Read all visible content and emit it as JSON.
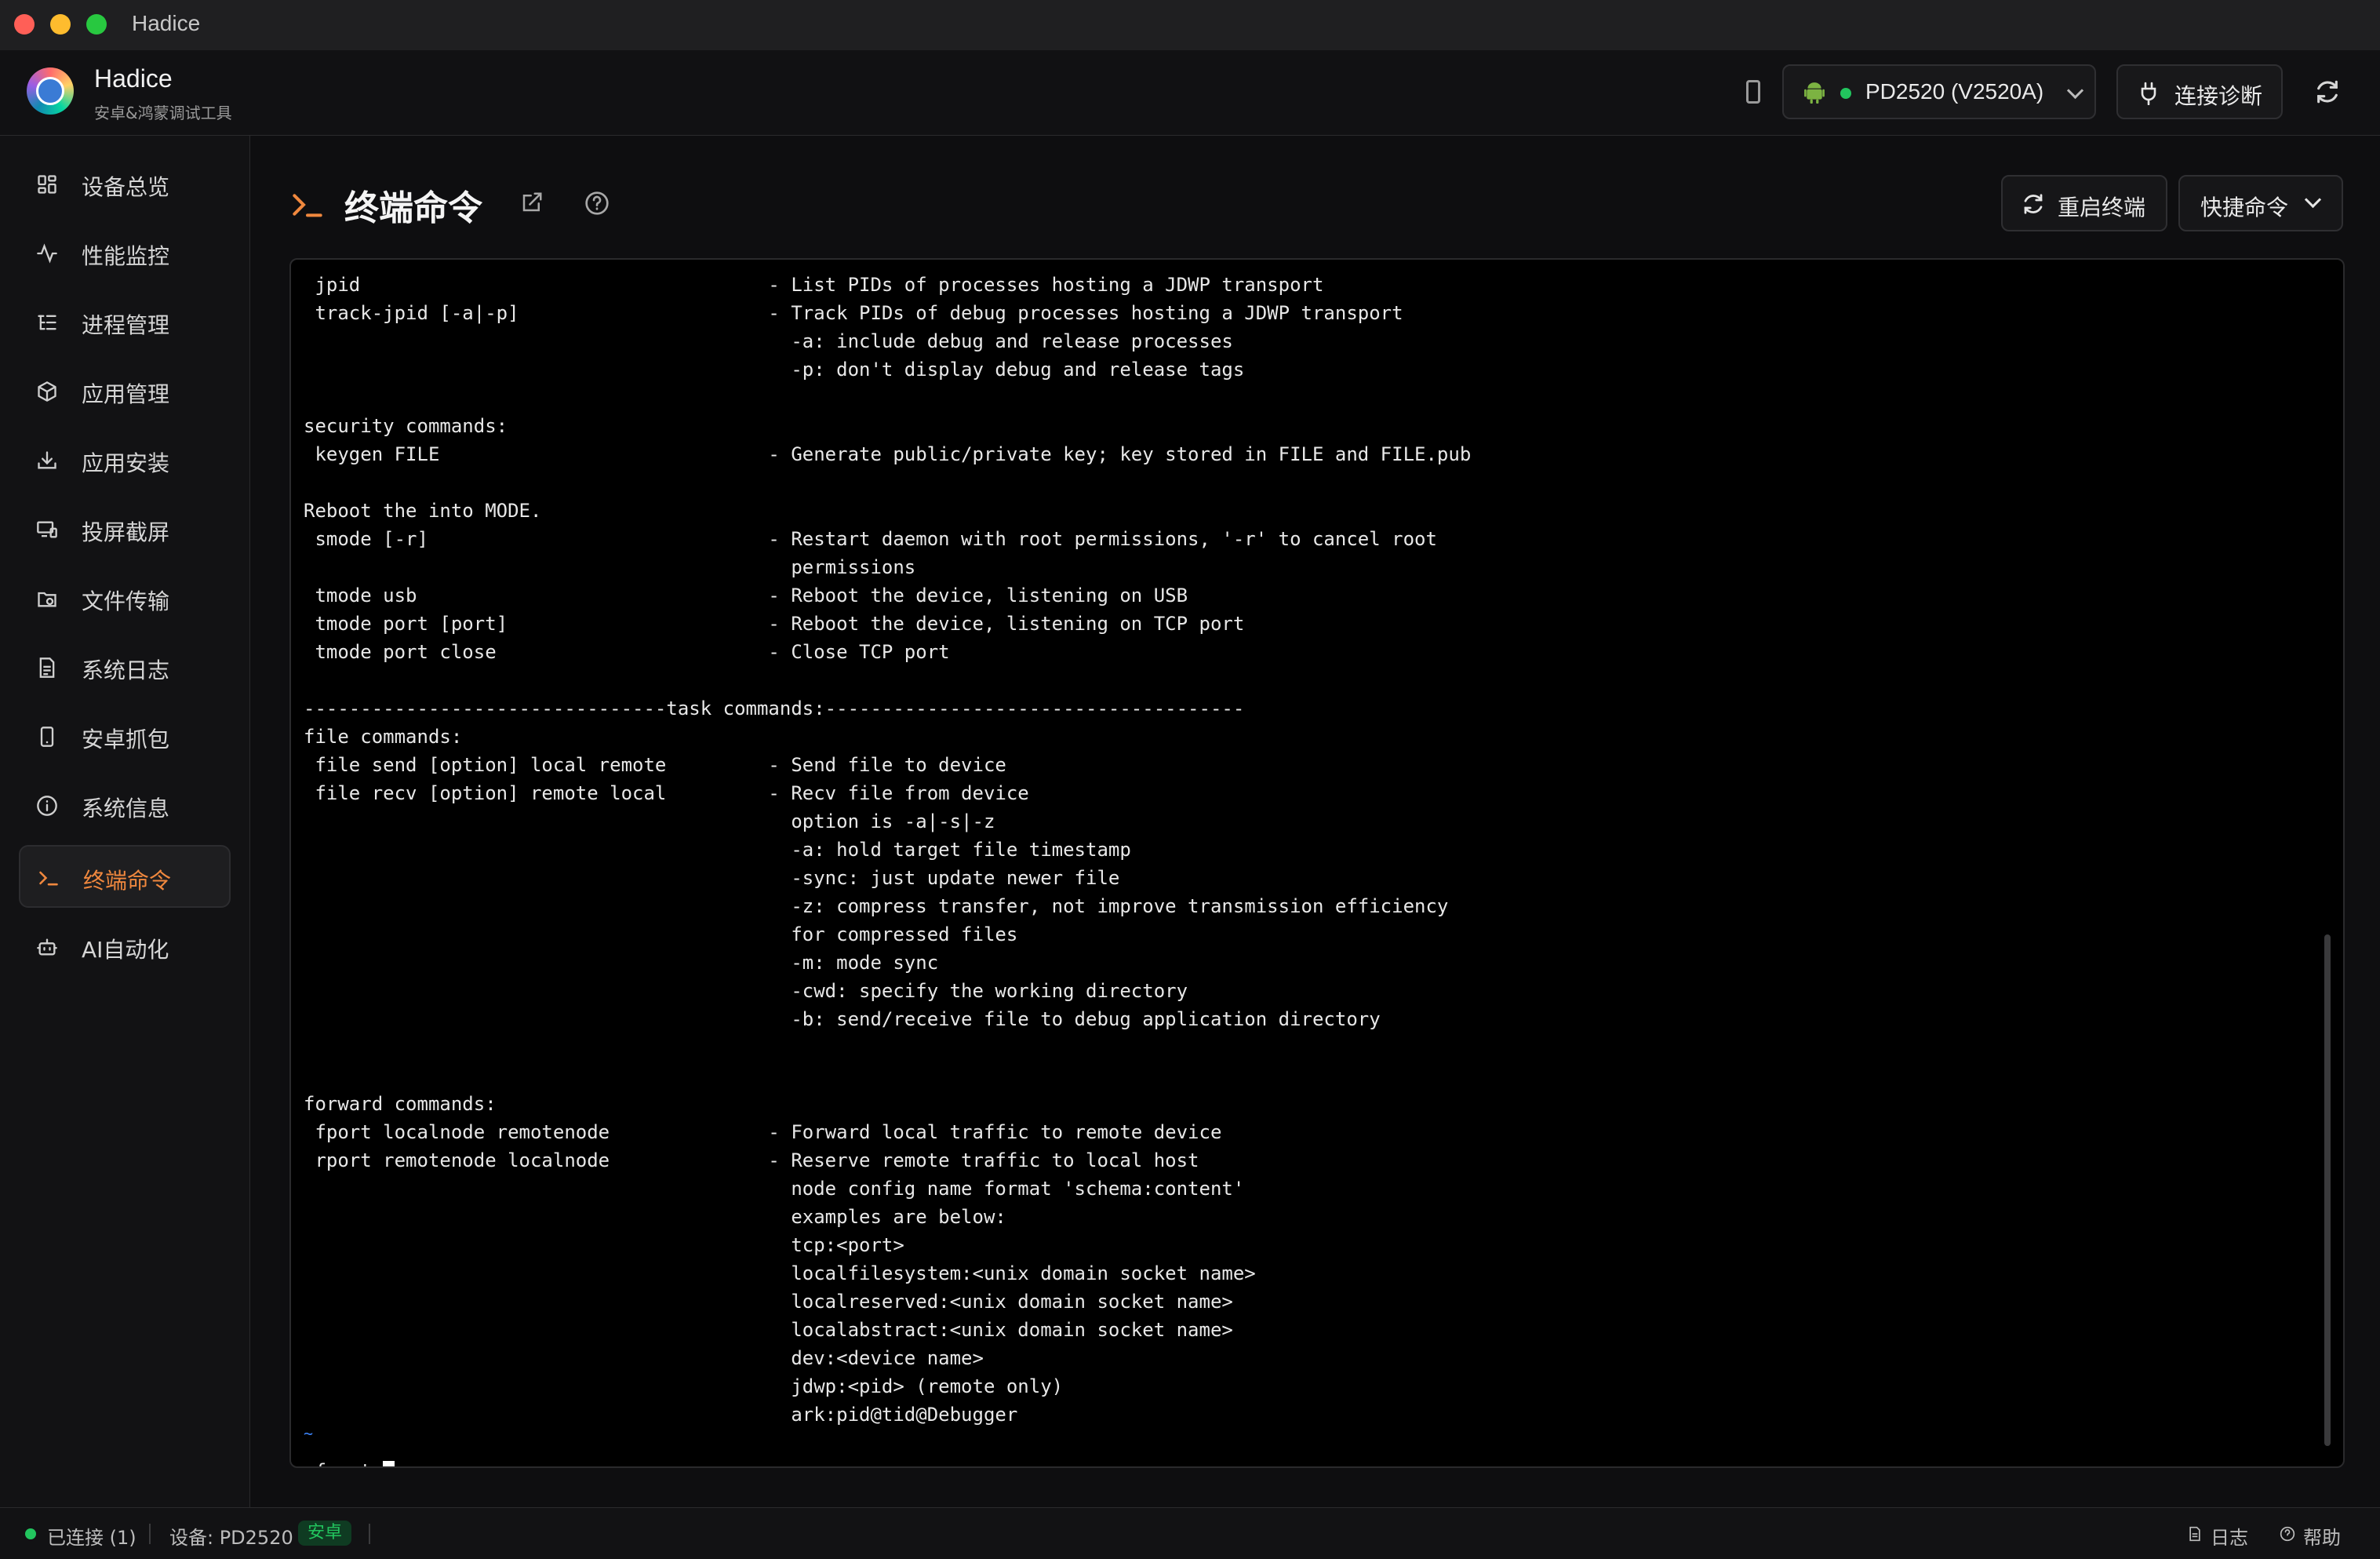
{
  "window": {
    "title": "Hadice"
  },
  "app": {
    "name": "Hadice",
    "subtitle": "安卓&鸿蒙调试工具"
  },
  "device": {
    "selected": "PD2520 (V2520A)",
    "status_color": "#22c55e"
  },
  "header": {
    "diagnose_label": "连接诊断"
  },
  "sidebar": {
    "items": [
      {
        "label": "设备总览",
        "icon": "grid-icon"
      },
      {
        "label": "性能监控",
        "icon": "activity-icon"
      },
      {
        "label": "进程管理",
        "icon": "list-tree-icon"
      },
      {
        "label": "应用管理",
        "icon": "package-icon"
      },
      {
        "label": "应用安装",
        "icon": "download-icon"
      },
      {
        "label": "投屏截屏",
        "icon": "cast-icon"
      },
      {
        "label": "文件传输",
        "icon": "folder-sync-icon"
      },
      {
        "label": "系统日志",
        "icon": "file-text-icon"
      },
      {
        "label": "安卓抓包",
        "icon": "smartphone-icon"
      },
      {
        "label": "系统信息",
        "icon": "info-icon"
      },
      {
        "label": "终端命令",
        "icon": "terminal-icon",
        "active": true
      },
      {
        "label": "AI自动化",
        "icon": "bot-icon"
      }
    ]
  },
  "page": {
    "title": "终端命令",
    "restart_label": "重启终端",
    "quick_label": "快捷命令"
  },
  "terminal": {
    "lines": [
      " jpid                                    - List PIDs of processes hosting a JDWP transport",
      " track-jpid [-a|-p]                      - Track PIDs of debug processes hosting a JDWP transport",
      "                                           -a: include debug and release processes",
      "                                           -p: don't display debug and release tags",
      "",
      "security commands:",
      " keygen FILE                             - Generate public/private key; key stored in FILE and FILE.pub",
      "",
      "Reboot the into MODE.",
      " smode [-r]                              - Restart daemon with root permissions, '-r' to cancel root",
      "                                           permissions",
      " tmode usb                               - Reboot the device, listening on USB",
      " tmode port [port]                       - Reboot the device, listening on TCP port",
      " tmode port close                        - Close TCP port",
      "",
      "--------------------------------task commands:-------------------------------------",
      "file commands:",
      " file send [option] local remote         - Send file to device",
      " file recv [option] remote local         - Recv file from device",
      "                                           option is -a|-s|-z",
      "                                           -a: hold target file timestamp",
      "                                           -sync: just update newer file",
      "                                           -z: compress transfer, not improve transmission efficiency",
      "                                           for compressed files",
      "                                           -m: mode sync",
      "                                           -cwd: specify the working directory",
      "                                           -b: send/receive file to debug application directory",
      "",
      "",
      "forward commands:",
      " fport localnode remotenode              - Forward local traffic to remote device",
      " rport remotenode localnode              - Reserve remote traffic to local host",
      "                                           node config name format 'schema:content'",
      "                                           examples are below:",
      "                                           tcp:<port>",
      "                                           localfilesystem:<unix domain socket name>",
      "                                           localreserved:<unix domain socket name>",
      "                                           localabstract:<unix domain socket name>",
      "                                           dev:<device name>",
      "                                           jdwp:<pid> (remote only)",
      "                                           ark:pid@tid@Debugger",
      ""
    ],
    "prompt": " fport ",
    "cursor_char": "%",
    "tilde": "~"
  },
  "status": {
    "connected": "已连接 (1)",
    "device": "设备: PD2520",
    "platform_tag": "安卓",
    "log_label": "日志",
    "help_label": "帮助"
  }
}
